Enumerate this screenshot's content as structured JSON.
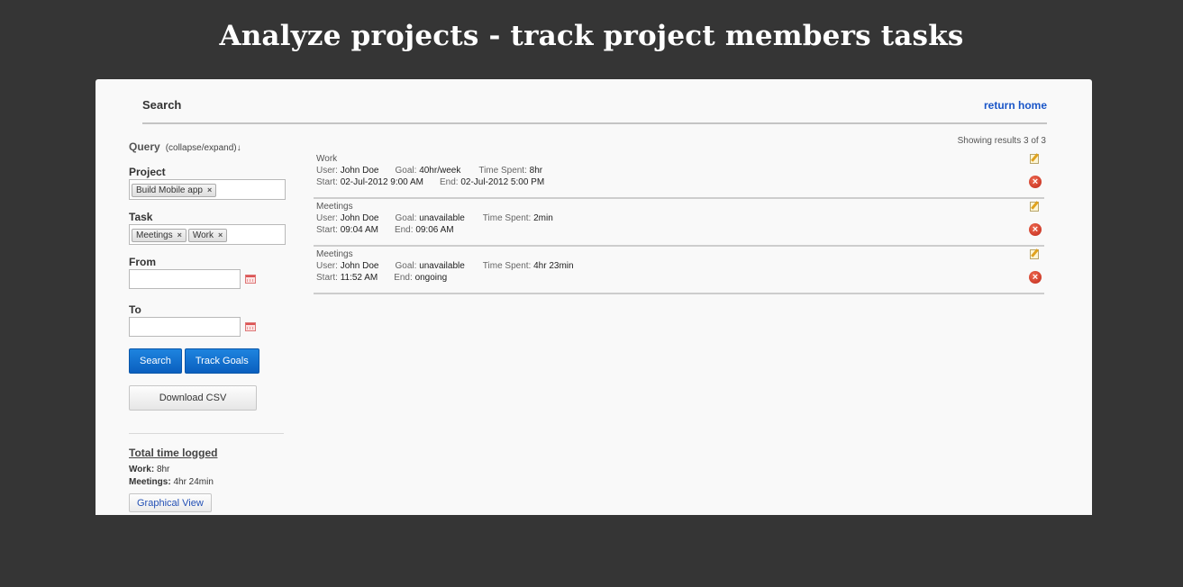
{
  "page_title": "Analyze projects - track project members tasks",
  "header": {
    "title": "Search",
    "return_link": "return home"
  },
  "query": {
    "label": "Query",
    "toggle": "(collapse/expand)↓",
    "project_label": "Project",
    "project_tags": [
      "Build Mobile app"
    ],
    "task_label": "Task",
    "task_tags": [
      "Meetings",
      "Work"
    ],
    "from_label": "From",
    "from_value": "",
    "to_label": "To",
    "to_value": "",
    "search_button": "Search",
    "track_goals_button": "Track Goals",
    "download_button": "Download CSV"
  },
  "totals": {
    "title": "Total time logged",
    "items": [
      {
        "name": "Work:",
        "value": "8hr"
      },
      {
        "name": "Meetings:",
        "value": "4hr 24min"
      }
    ],
    "graph_button": "Graphical View"
  },
  "results_count": "Showing results 3 of 3",
  "labels": {
    "user": "User:",
    "goal": "Goal:",
    "time_spent": "Time Spent:",
    "start": "Start:",
    "end": "End:"
  },
  "results": [
    {
      "task": "Work",
      "user": "John Doe",
      "goal": "40hr/week",
      "time_spent": "8hr",
      "start": "02-Jul-2012 9:00 AM",
      "end": "02-Jul-2012 5:00 PM"
    },
    {
      "task": "Meetings",
      "user": "John Doe",
      "goal": "unavailable",
      "time_spent": "2min",
      "start": "09:04 AM",
      "end": "09:06 AM"
    },
    {
      "task": "Meetings",
      "user": "John Doe",
      "goal": "unavailable",
      "time_spent": "4hr 23min",
      "start": "11:52 AM",
      "end": "ongoing"
    }
  ],
  "icons": {
    "edit": "edit-icon",
    "delete": "delete-icon",
    "calendar": "calendar-icon",
    "remove_tag": "×",
    "delete_glyph": "×"
  },
  "colors": {
    "background": "#353535",
    "panel": "#f9f9f9",
    "link": "#1a56c8",
    "primary_button": "#0a5fbf",
    "delete": "#c0291b"
  }
}
